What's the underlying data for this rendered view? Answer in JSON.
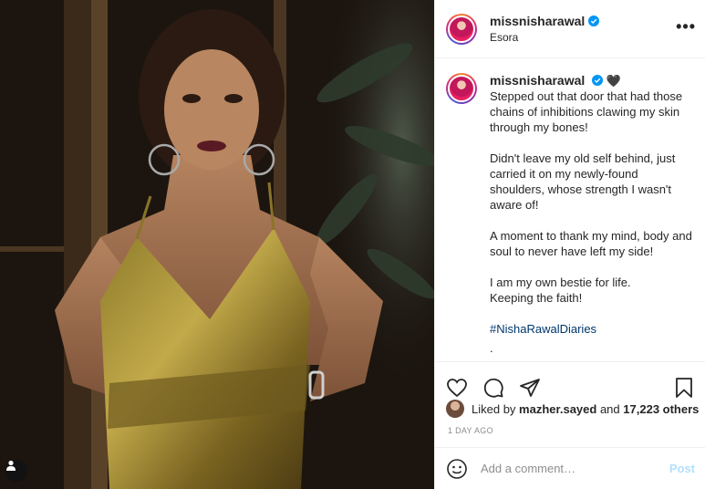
{
  "photo": {
    "alt": "Photo by missnisharawal",
    "user_tag_icon": "person-icon"
  },
  "header": {
    "username": "missnisharawal",
    "location": "Esora",
    "more_icon": "more-horizontal-icon",
    "more_label": "•••"
  },
  "caption": {
    "username": "missnisharawal",
    "emoji": "🖤",
    "paragraphs": [
      "Stepped out that door that had those chains of inhibitions clawing my skin through my bones!",
      "Didn't leave my old self behind, just carried it on my newly-found shoulders, whose strength I wasn't aware of!",
      "A moment to thank my mind, body and soul to never have left my side!",
      "I am my own bestie for life.\nKeeping the faith!"
    ],
    "hashtag": "#NishaRawalDiaries",
    "dots": [
      ".",
      "."
    ]
  },
  "actions": {
    "like_icon": "heart-icon",
    "comment_icon": "comment-icon",
    "share_icon": "paper-plane-icon",
    "save_icon": "bookmark-icon"
  },
  "likes": {
    "prefix": "Liked by",
    "user": "mazher.sayed",
    "middle": "and",
    "count": "17,223 others"
  },
  "timestamp": "1 DAY AGO",
  "comment": {
    "emoji_icon": "smiley-icon",
    "placeholder": "Add a comment…",
    "post_label": "Post"
  },
  "colors": {
    "accent_blue": "#0095f6",
    "post_disabled": "#b2dffc",
    "hashtag": "#00376b",
    "muted": "#8e8e8e"
  }
}
